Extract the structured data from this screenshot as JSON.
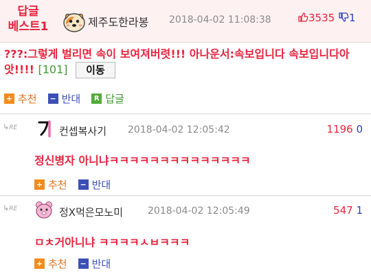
{
  "best": {
    "badge_line1": "답글",
    "badge_line2": "베스트1",
    "nickname": "제주도한라봉",
    "date": "2018-04-02 11:08:38",
    "upvotes": "3535",
    "downvotes": "1"
  },
  "post": {
    "text": "???:그렇게 벌리면 속이 보여져버렷!!! 아나운서:속보입니다 속보입니다아앗!!!!",
    "count": "[101]",
    "move_label": "이동",
    "actions": {
      "up": "추천",
      "down": "반대",
      "reply": "답글"
    }
  },
  "comments": [
    {
      "re": "RE",
      "nickname": "컨셉복사기",
      "date": "2018-04-02 12:05:42",
      "upvotes": "1196",
      "downvotes": "0",
      "text": "정신병자 아니냐ㅋㅋㅋㅋㅋㅋㅋㅋㅋㅋㅋㅋㅋㅋ",
      "actions": {
        "up": "추천",
        "down": "반대"
      }
    },
    {
      "re": "RE",
      "nickname": "정X먹은모노미",
      "date": "2018-04-02 12:05:49",
      "upvotes": "547",
      "downvotes": "1",
      "text": "ㅁㅊ거아니냐 ㅋㅋㅋㅋㅅㅂㅋㅋㅋ",
      "actions": {
        "up": "추천",
        "down": "반대"
      }
    }
  ],
  "colors": {
    "accent_red": "#e6233d",
    "down_blue": "#2a3fbf",
    "reply_green": "#3f9a2e",
    "up_orange": "#f08c1e"
  },
  "icons": [
    "hamster-avatar-icon",
    "thumbs-up-icon",
    "thumbs-down-icon",
    "reply-arrow-icon",
    "plus-icon",
    "minus-icon",
    "reply-r-icon",
    "pink-bear-avatar-icon"
  ]
}
